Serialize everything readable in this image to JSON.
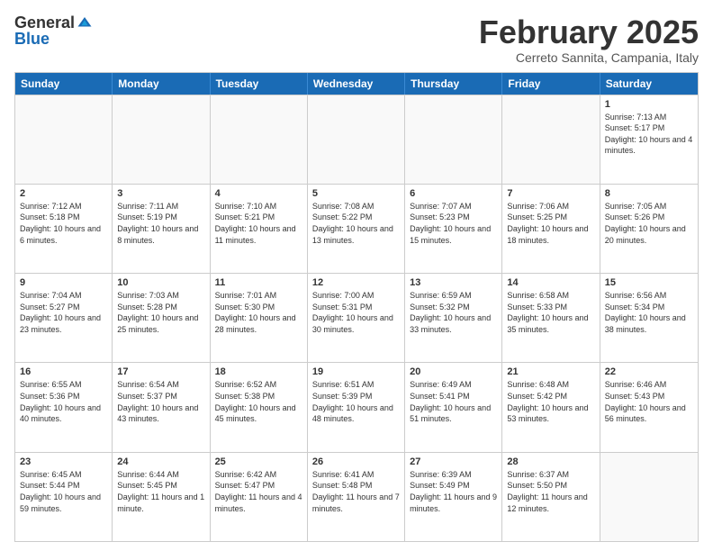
{
  "header": {
    "logo_general": "General",
    "logo_blue": "Blue",
    "month_title": "February 2025",
    "location": "Cerreto Sannita, Campania, Italy"
  },
  "weekdays": [
    "Sunday",
    "Monday",
    "Tuesday",
    "Wednesday",
    "Thursday",
    "Friday",
    "Saturday"
  ],
  "rows": [
    [
      {
        "day": "",
        "info": ""
      },
      {
        "day": "",
        "info": ""
      },
      {
        "day": "",
        "info": ""
      },
      {
        "day": "",
        "info": ""
      },
      {
        "day": "",
        "info": ""
      },
      {
        "day": "",
        "info": ""
      },
      {
        "day": "1",
        "info": "Sunrise: 7:13 AM\nSunset: 5:17 PM\nDaylight: 10 hours and 4 minutes."
      }
    ],
    [
      {
        "day": "2",
        "info": "Sunrise: 7:12 AM\nSunset: 5:18 PM\nDaylight: 10 hours and 6 minutes."
      },
      {
        "day": "3",
        "info": "Sunrise: 7:11 AM\nSunset: 5:19 PM\nDaylight: 10 hours and 8 minutes."
      },
      {
        "day": "4",
        "info": "Sunrise: 7:10 AM\nSunset: 5:21 PM\nDaylight: 10 hours and 11 minutes."
      },
      {
        "day": "5",
        "info": "Sunrise: 7:08 AM\nSunset: 5:22 PM\nDaylight: 10 hours and 13 minutes."
      },
      {
        "day": "6",
        "info": "Sunrise: 7:07 AM\nSunset: 5:23 PM\nDaylight: 10 hours and 15 minutes."
      },
      {
        "day": "7",
        "info": "Sunrise: 7:06 AM\nSunset: 5:25 PM\nDaylight: 10 hours and 18 minutes."
      },
      {
        "day": "8",
        "info": "Sunrise: 7:05 AM\nSunset: 5:26 PM\nDaylight: 10 hours and 20 minutes."
      }
    ],
    [
      {
        "day": "9",
        "info": "Sunrise: 7:04 AM\nSunset: 5:27 PM\nDaylight: 10 hours and 23 minutes."
      },
      {
        "day": "10",
        "info": "Sunrise: 7:03 AM\nSunset: 5:28 PM\nDaylight: 10 hours and 25 minutes."
      },
      {
        "day": "11",
        "info": "Sunrise: 7:01 AM\nSunset: 5:30 PM\nDaylight: 10 hours and 28 minutes."
      },
      {
        "day": "12",
        "info": "Sunrise: 7:00 AM\nSunset: 5:31 PM\nDaylight: 10 hours and 30 minutes."
      },
      {
        "day": "13",
        "info": "Sunrise: 6:59 AM\nSunset: 5:32 PM\nDaylight: 10 hours and 33 minutes."
      },
      {
        "day": "14",
        "info": "Sunrise: 6:58 AM\nSunset: 5:33 PM\nDaylight: 10 hours and 35 minutes."
      },
      {
        "day": "15",
        "info": "Sunrise: 6:56 AM\nSunset: 5:34 PM\nDaylight: 10 hours and 38 minutes."
      }
    ],
    [
      {
        "day": "16",
        "info": "Sunrise: 6:55 AM\nSunset: 5:36 PM\nDaylight: 10 hours and 40 minutes."
      },
      {
        "day": "17",
        "info": "Sunrise: 6:54 AM\nSunset: 5:37 PM\nDaylight: 10 hours and 43 minutes."
      },
      {
        "day": "18",
        "info": "Sunrise: 6:52 AM\nSunset: 5:38 PM\nDaylight: 10 hours and 45 minutes."
      },
      {
        "day": "19",
        "info": "Sunrise: 6:51 AM\nSunset: 5:39 PM\nDaylight: 10 hours and 48 minutes."
      },
      {
        "day": "20",
        "info": "Sunrise: 6:49 AM\nSunset: 5:41 PM\nDaylight: 10 hours and 51 minutes."
      },
      {
        "day": "21",
        "info": "Sunrise: 6:48 AM\nSunset: 5:42 PM\nDaylight: 10 hours and 53 minutes."
      },
      {
        "day": "22",
        "info": "Sunrise: 6:46 AM\nSunset: 5:43 PM\nDaylight: 10 hours and 56 minutes."
      }
    ],
    [
      {
        "day": "23",
        "info": "Sunrise: 6:45 AM\nSunset: 5:44 PM\nDaylight: 10 hours and 59 minutes."
      },
      {
        "day": "24",
        "info": "Sunrise: 6:44 AM\nSunset: 5:45 PM\nDaylight: 11 hours and 1 minute."
      },
      {
        "day": "25",
        "info": "Sunrise: 6:42 AM\nSunset: 5:47 PM\nDaylight: 11 hours and 4 minutes."
      },
      {
        "day": "26",
        "info": "Sunrise: 6:41 AM\nSunset: 5:48 PM\nDaylight: 11 hours and 7 minutes."
      },
      {
        "day": "27",
        "info": "Sunrise: 6:39 AM\nSunset: 5:49 PM\nDaylight: 11 hours and 9 minutes."
      },
      {
        "day": "28",
        "info": "Sunrise: 6:37 AM\nSunset: 5:50 PM\nDaylight: 11 hours and 12 minutes."
      },
      {
        "day": "",
        "info": ""
      }
    ]
  ]
}
